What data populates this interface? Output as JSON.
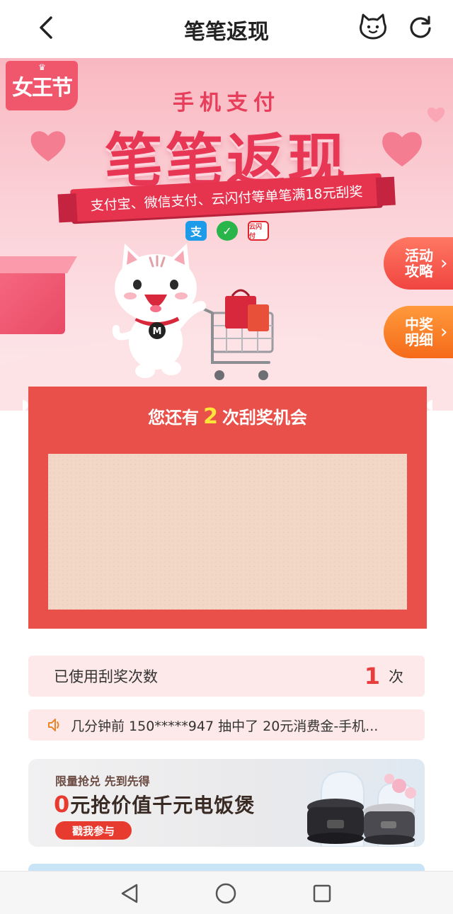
{
  "header": {
    "title": "笔笔返现"
  },
  "hero": {
    "badge_text": "女王节",
    "subtitle": "手机支付",
    "title": "笔笔返现",
    "ribbon_text": "支付宝、微信支付、云闪付等单笔满18元刮奖",
    "pay_methods": [
      "支",
      "✓",
      "云闪付"
    ],
    "side_buttons": {
      "rules": "活动攻略",
      "wins": "中奖明细"
    }
  },
  "scratch_card": {
    "prefix": "您还有",
    "count": "2",
    "suffix": "次刮奖机会"
  },
  "used": {
    "label": "已使用刮奖次数",
    "count": "1",
    "unit": "次"
  },
  "ticker": {
    "text": "几分钟前 150*****947 抽中了 20元消费金-手机..."
  },
  "promo": {
    "subtitle": "限量抢兑 先到先得",
    "title_zero": "0",
    "title_rest": "元抢价值千元电饭煲",
    "button": "戳我参与"
  },
  "colors": {
    "primary_red": "#e9504a",
    "accent_yellow": "#ffe43a",
    "scratch_area": "#f3d7c6",
    "pink_bg": "#fde9ea",
    "side_rules": "#f04540",
    "side_wins": "#f56a1a"
  },
  "icons": {
    "header": [
      "chevron-left-icon",
      "cat-face-icon",
      "refresh-icon"
    ],
    "ticker": "speaker-icon",
    "android_nav": [
      "triangle-back-icon",
      "circle-home-icon",
      "square-recent-icon"
    ]
  }
}
